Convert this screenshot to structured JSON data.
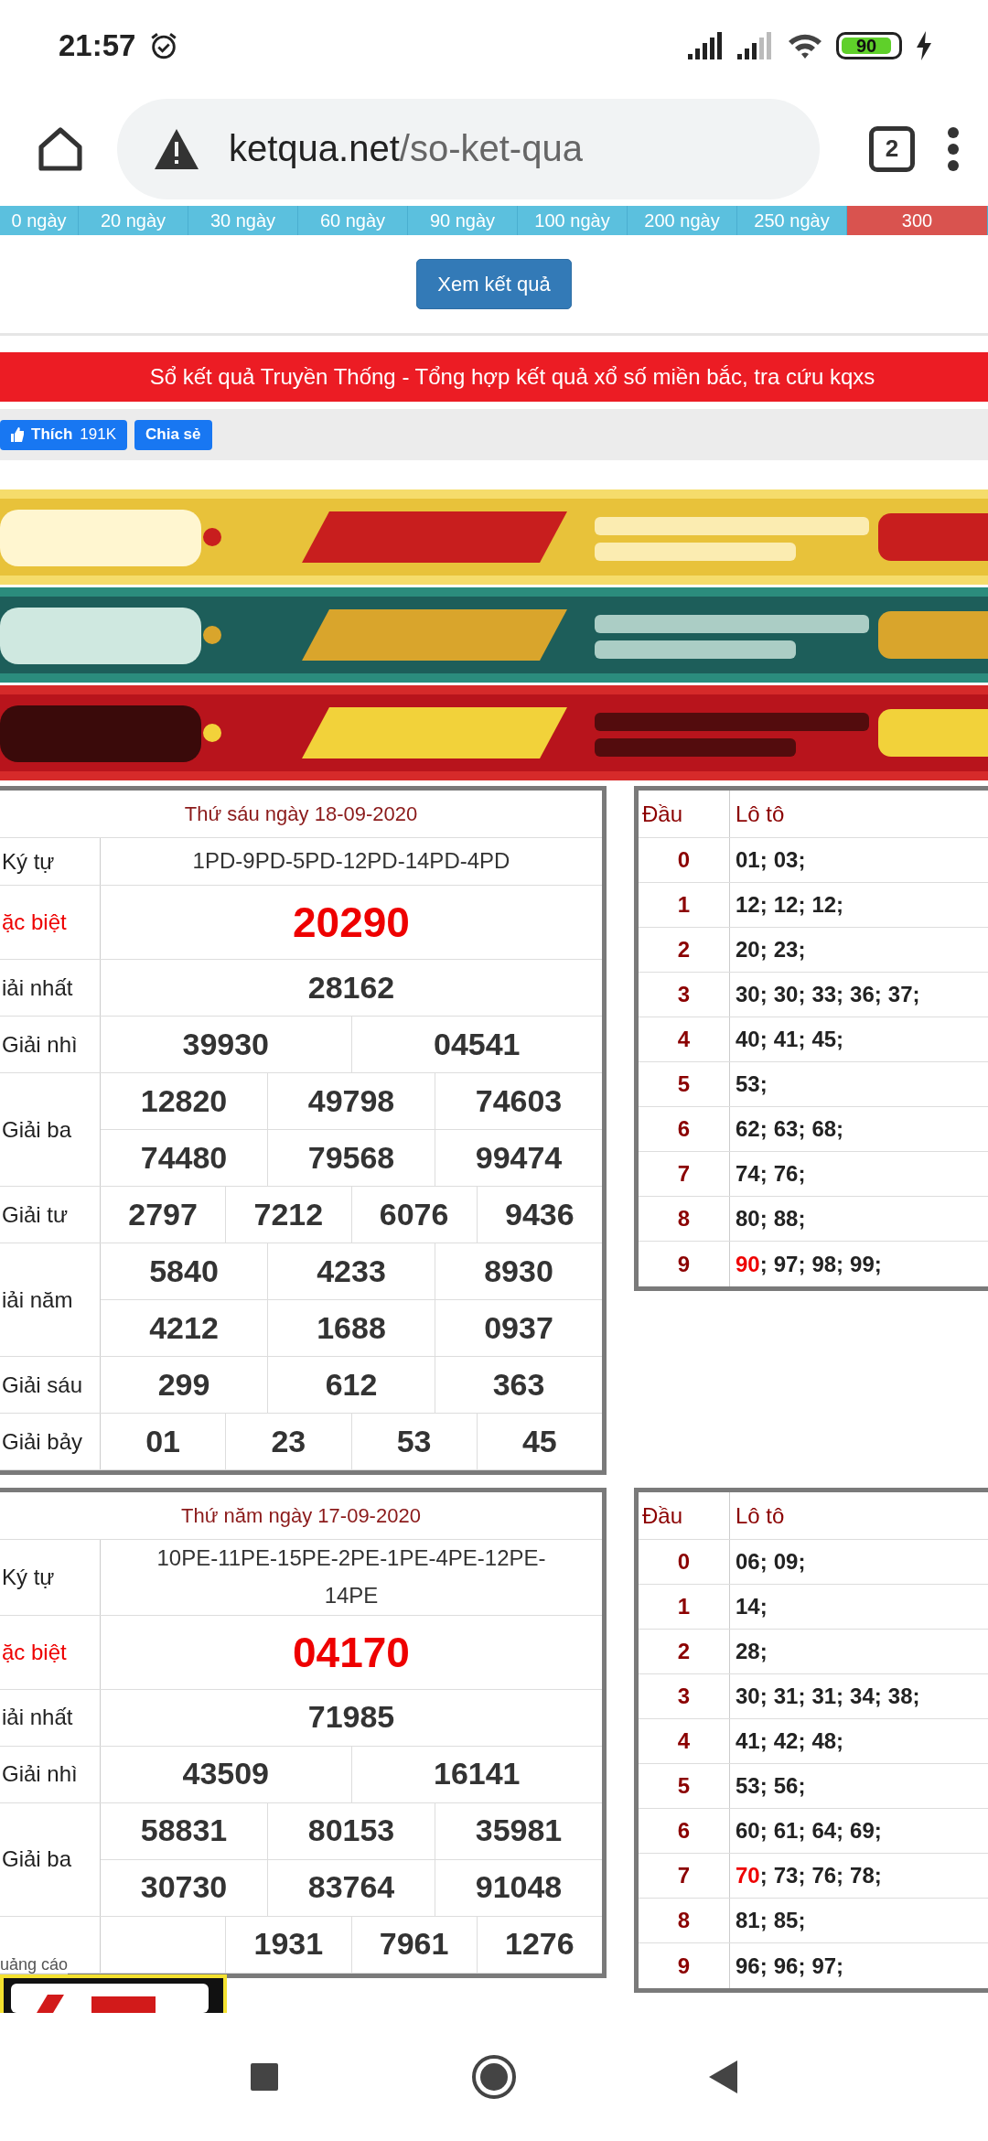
{
  "status": {
    "time": "21:57",
    "battery": "90"
  },
  "browser": {
    "host": "ketqua.net",
    "path": "/so-ket-qua",
    "tab_count": "2"
  },
  "periods": [
    {
      "label": "0 ngày",
      "selected": false
    },
    {
      "label": "20 ngày",
      "selected": false
    },
    {
      "label": "30 ngày",
      "selected": false
    },
    {
      "label": "60 ngày",
      "selected": false
    },
    {
      "label": "90 ngày",
      "selected": false
    },
    {
      "label": "100 ngày",
      "selected": false
    },
    {
      "label": "200 ngày",
      "selected": false
    },
    {
      "label": "250 ngày",
      "selected": false
    },
    {
      "label": "300",
      "selected": true
    }
  ],
  "view_button": "Xem kết quả",
  "headline": "Sổ kết quả Truyền Thống - Tổng hợp kết quả xổ số miền bắc, tra cứu kqxs",
  "social": [
    {
      "kind": "like",
      "label": "Thích",
      "count": "191K"
    },
    {
      "kind": "share",
      "label": "Chia sẻ"
    }
  ],
  "results": [
    {
      "date": "Thứ sáu ngày 18-09-2020",
      "rows": [
        {
          "kind": "code",
          "label": "Ký tự",
          "lines": [
            [
              "1PD-9PD-5PD-12PD-14PD-4PD"
            ]
          ]
        },
        {
          "kind": "special",
          "label": "ặc biệt",
          "lines": [
            [
              "20290"
            ]
          ]
        },
        {
          "kind": "prize",
          "label": "iải nhất",
          "lines": [
            [
              "28162"
            ]
          ]
        },
        {
          "kind": "prize",
          "label": "Giải nhì",
          "lines": [
            [
              "39930",
              "04541"
            ]
          ]
        },
        {
          "kind": "prize",
          "label": "Giải ba",
          "lines": [
            [
              "12820",
              "49798",
              "74603"
            ],
            [
              "74480",
              "79568",
              "99474"
            ]
          ]
        },
        {
          "kind": "prize",
          "label": "Giải tư",
          "lines": [
            [
              "2797",
              "7212",
              "6076",
              "9436"
            ]
          ]
        },
        {
          "kind": "prize",
          "label": "iải năm",
          "lines": [
            [
              "5840",
              "4233",
              "8930"
            ],
            [
              "4212",
              "1688",
              "0937"
            ]
          ]
        },
        {
          "kind": "prize",
          "label": "Giải sáu",
          "lines": [
            [
              "299",
              "612",
              "363"
            ]
          ]
        },
        {
          "kind": "prize",
          "label": "Giải bảy",
          "lines": [
            [
              "01",
              "23",
              "53",
              "45"
            ]
          ]
        }
      ],
      "loto": {
        "head_title": "Đầu",
        "values_title": "Lô tô",
        "separator": ";",
        "rows": [
          {
            "head": "0",
            "items": [
              {
                "n": "01",
                "hit": false
              },
              {
                "n": "03",
                "hit": false
              }
            ]
          },
          {
            "head": "1",
            "items": [
              {
                "n": "12",
                "hit": false
              },
              {
                "n": "12",
                "hit": false
              },
              {
                "n": "12",
                "hit": false
              }
            ]
          },
          {
            "head": "2",
            "items": [
              {
                "n": "20",
                "hit": false
              },
              {
                "n": "23",
                "hit": false
              }
            ]
          },
          {
            "head": "3",
            "items": [
              {
                "n": "30",
                "hit": false
              },
              {
                "n": "30",
                "hit": false
              },
              {
                "n": "33",
                "hit": false
              },
              {
                "n": "36",
                "hit": false
              },
              {
                "n": "37",
                "hit": false
              }
            ]
          },
          {
            "head": "4",
            "items": [
              {
                "n": "40",
                "hit": false
              },
              {
                "n": "41",
                "hit": false
              },
              {
                "n": "45",
                "hit": false
              }
            ]
          },
          {
            "head": "5",
            "items": [
              {
                "n": "53",
                "hit": false
              }
            ]
          },
          {
            "head": "6",
            "items": [
              {
                "n": "62",
                "hit": false
              },
              {
                "n": "63",
                "hit": false
              },
              {
                "n": "68",
                "hit": false
              }
            ]
          },
          {
            "head": "7",
            "items": [
              {
                "n": "74",
                "hit": false
              },
              {
                "n": "76",
                "hit": false
              }
            ]
          },
          {
            "head": "8",
            "items": [
              {
                "n": "80",
                "hit": false
              },
              {
                "n": "88",
                "hit": false
              }
            ]
          },
          {
            "head": "9",
            "items": [
              {
                "n": "90",
                "hit": true
              },
              {
                "n": "97",
                "hit": false
              },
              {
                "n": "98",
                "hit": false
              },
              {
                "n": "99",
                "hit": false
              }
            ]
          }
        ]
      }
    },
    {
      "date": "Thứ năm ngày 17-09-2020",
      "rows": [
        {
          "kind": "code",
          "label": "Ký tự",
          "lines": [
            [
              "10PE-11PE-15PE-2PE-1PE-4PE-12PE-14PE"
            ]
          ]
        },
        {
          "kind": "special",
          "label": "ặc biệt",
          "lines": [
            [
              "04170"
            ]
          ]
        },
        {
          "kind": "prize",
          "label": "iải nhất",
          "lines": [
            [
              "71985"
            ]
          ]
        },
        {
          "kind": "prize",
          "label": "Giải nhì",
          "lines": [
            [
              "43509",
              "16141"
            ]
          ]
        },
        {
          "kind": "prize",
          "label": "Giải ba",
          "lines": [
            [
              "58831",
              "80153",
              "35981"
            ],
            [
              "30730",
              "83764",
              "91048"
            ]
          ]
        },
        {
          "kind": "covered",
          "lines": [
            [
              "1931",
              "7961",
              "1276"
            ]
          ]
        }
      ],
      "loto": {
        "head_title": "Đầu",
        "values_title": "Lô tô",
        "separator": ";",
        "rows": [
          {
            "head": "0",
            "items": [
              {
                "n": "06",
                "hit": false
              },
              {
                "n": "09",
                "hit": false
              }
            ]
          },
          {
            "head": "1",
            "items": [
              {
                "n": "14",
                "hit": false
              }
            ]
          },
          {
            "head": "2",
            "items": [
              {
                "n": "28",
                "hit": false
              }
            ]
          },
          {
            "head": "3",
            "items": [
              {
                "n": "30",
                "hit": false
              },
              {
                "n": "31",
                "hit": false
              },
              {
                "n": "31",
                "hit": false
              },
              {
                "n": "34",
                "hit": false
              },
              {
                "n": "38",
                "hit": false
              }
            ]
          },
          {
            "head": "4",
            "items": [
              {
                "n": "41",
                "hit": false
              },
              {
                "n": "42",
                "hit": false
              },
              {
                "n": "48",
                "hit": false
              }
            ]
          },
          {
            "head": "5",
            "items": [
              {
                "n": "53",
                "hit": false
              },
              {
                "n": "56",
                "hit": false
              }
            ]
          },
          {
            "head": "6",
            "items": [
              {
                "n": "60",
                "hit": false
              },
              {
                "n": "61",
                "hit": false
              },
              {
                "n": "64",
                "hit": false
              },
              {
                "n": "69",
                "hit": false
              }
            ]
          },
          {
            "head": "7",
            "items": [
              {
                "n": "70",
                "hit": true
              },
              {
                "n": "73",
                "hit": false
              },
              {
                "n": "76",
                "hit": false
              },
              {
                "n": "78",
                "hit": false
              }
            ]
          },
          {
            "head": "8",
            "items": [
              {
                "n": "81",
                "hit": false
              },
              {
                "n": "85",
                "hit": false
              }
            ]
          },
          {
            "head": "9",
            "items": [
              {
                "n": "96",
                "hit": false
              },
              {
                "n": "96",
                "hit": false
              },
              {
                "n": "97",
                "hit": false
              }
            ]
          }
        ]
      }
    }
  ],
  "overlay_ad": {
    "label": "uảng cáo"
  }
}
